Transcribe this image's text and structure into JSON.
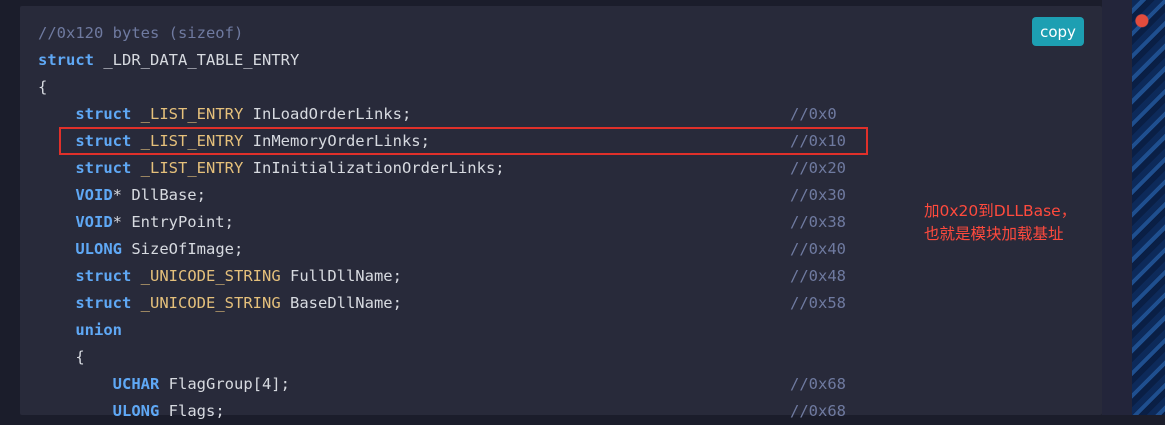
{
  "code_block": {
    "copy_label": "copy",
    "lines": [
      {
        "indent": "",
        "parts": [
          {
            "cls": "cm",
            "text": "//0x120 bytes (sizeof)"
          }
        ],
        "offset": ""
      },
      {
        "indent": "",
        "parts": [
          {
            "cls": "kw",
            "text": "struct"
          },
          {
            "cls": "pl",
            "text": " _LDR_DATA_TABLE_ENTRY"
          }
        ],
        "offset": ""
      },
      {
        "indent": "",
        "parts": [
          {
            "cls": "pl",
            "text": "{"
          }
        ],
        "offset": ""
      },
      {
        "indent": "    ",
        "parts": [
          {
            "cls": "kw",
            "text": "struct"
          },
          {
            "cls": "pl",
            "text": " "
          },
          {
            "cls": "ty",
            "text": "_LIST_ENTRY"
          },
          {
            "cls": "pl",
            "text": " InLoadOrderLinks;"
          }
        ],
        "offset": "//0x0"
      },
      {
        "indent": "    ",
        "parts": [
          {
            "cls": "kw",
            "text": "struct"
          },
          {
            "cls": "pl",
            "text": " "
          },
          {
            "cls": "ty",
            "text": "_LIST_ENTRY"
          },
          {
            "cls": "pl",
            "text": " InMemoryOrderLinks;"
          }
        ],
        "offset": "//0x10"
      },
      {
        "indent": "    ",
        "parts": [
          {
            "cls": "kw",
            "text": "struct"
          },
          {
            "cls": "pl",
            "text": " "
          },
          {
            "cls": "ty",
            "text": "_LIST_ENTRY"
          },
          {
            "cls": "pl",
            "text": " InInitializationOrderLinks;"
          }
        ],
        "offset": "//0x20"
      },
      {
        "indent": "    ",
        "parts": [
          {
            "cls": "kw",
            "text": "VOID"
          },
          {
            "cls": "pl",
            "text": "* DllBase;"
          }
        ],
        "offset": "//0x30"
      },
      {
        "indent": "    ",
        "parts": [
          {
            "cls": "kw",
            "text": "VOID"
          },
          {
            "cls": "pl",
            "text": "* EntryPoint;"
          }
        ],
        "offset": "//0x38"
      },
      {
        "indent": "    ",
        "parts": [
          {
            "cls": "kw",
            "text": "ULONG"
          },
          {
            "cls": "pl",
            "text": " SizeOfImage;"
          }
        ],
        "offset": "//0x40"
      },
      {
        "indent": "    ",
        "parts": [
          {
            "cls": "kw",
            "text": "struct"
          },
          {
            "cls": "pl",
            "text": " "
          },
          {
            "cls": "ty",
            "text": "_UNICODE_STRING"
          },
          {
            "cls": "pl",
            "text": " FullDllName;"
          }
        ],
        "offset": "//0x48"
      },
      {
        "indent": "    ",
        "parts": [
          {
            "cls": "kw",
            "text": "struct"
          },
          {
            "cls": "pl",
            "text": " "
          },
          {
            "cls": "ty",
            "text": "_UNICODE_STRING"
          },
          {
            "cls": "pl",
            "text": " BaseDllName;"
          }
        ],
        "offset": "//0x58"
      },
      {
        "indent": "    ",
        "parts": [
          {
            "cls": "kw",
            "text": "union"
          }
        ],
        "offset": ""
      },
      {
        "indent": "    ",
        "parts": [
          {
            "cls": "pl",
            "text": "{"
          }
        ],
        "offset": ""
      },
      {
        "indent": "        ",
        "parts": [
          {
            "cls": "kw",
            "text": "UCHAR"
          },
          {
            "cls": "pl",
            "text": " FlagGroup[4];"
          }
        ],
        "offset": "//0x68"
      },
      {
        "indent": "        ",
        "parts": [
          {
            "cls": "kw",
            "text": "ULONG"
          },
          {
            "cls": "pl",
            "text": " Flags;"
          }
        ],
        "offset": "//0x68"
      }
    ]
  },
  "annotation": {
    "line1": "加0x20到DLLBase，",
    "line2": "也就是模块加载基址",
    "color": "#ff4a3d"
  },
  "highlight": {
    "color": "#e0302a",
    "line_index": 4
  }
}
